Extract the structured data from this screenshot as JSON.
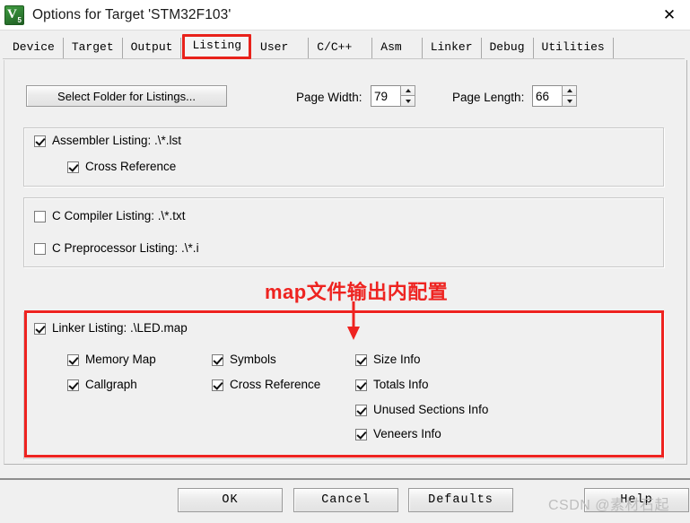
{
  "window": {
    "title": "Options for Target 'STM32F103'",
    "icon": "keil-uvision5-icon",
    "icon_letter": "V",
    "icon_sub": "5",
    "close_label": "✕"
  },
  "tabs": [
    {
      "label": "Device",
      "active": false
    },
    {
      "label": "Target",
      "active": false
    },
    {
      "label": "Output",
      "active": false
    },
    {
      "label": "Listing",
      "active": true
    },
    {
      "label": "User",
      "active": false
    },
    {
      "label": "C/C++",
      "active": false
    },
    {
      "label": "Asm",
      "active": false
    },
    {
      "label": "Linker",
      "active": false
    },
    {
      "label": "Debug",
      "active": false
    },
    {
      "label": "Utilities",
      "active": false
    }
  ],
  "toolbar": {
    "select_folder_label": "Select Folder for Listings...",
    "page_width_label": "Page Width:",
    "page_width_value": "79",
    "page_length_label": "Page Length:",
    "page_length_value": "66"
  },
  "assembler_group": {
    "listing_label": "Assembler Listing:  .\\*.lst",
    "listing_checked": true,
    "cross_reference_label": "Cross Reference",
    "cross_reference_checked": true
  },
  "compiler_group": {
    "c_compiler_label": "C Compiler Listing:  .\\*.txt",
    "c_compiler_checked": false,
    "c_preprocessor_label": "C Preprocessor Listing:  .\\*.i",
    "c_preprocessor_checked": false
  },
  "linker_group": {
    "listing_label": "Linker Listing:  .\\LED.map",
    "listing_checked": true,
    "options": [
      {
        "label": "Memory Map",
        "checked": true
      },
      {
        "label": "Callgraph",
        "checked": true
      },
      {
        "label": "Symbols",
        "checked": true
      },
      {
        "label": "Cross Reference",
        "checked": true
      },
      {
        "label": "Size Info",
        "checked": true
      },
      {
        "label": "Totals Info",
        "checked": true
      },
      {
        "label": "Unused Sections Info",
        "checked": true
      },
      {
        "label": "Veneers Info",
        "checked": true
      }
    ]
  },
  "annotation": {
    "text": "map文件输出内配置",
    "color": "#ee2320"
  },
  "footer": {
    "ok_label": "OK",
    "cancel_label": "Cancel",
    "defaults_label": "Defaults",
    "help_label": "Help",
    "watermark": "CSDN @素材石起"
  }
}
